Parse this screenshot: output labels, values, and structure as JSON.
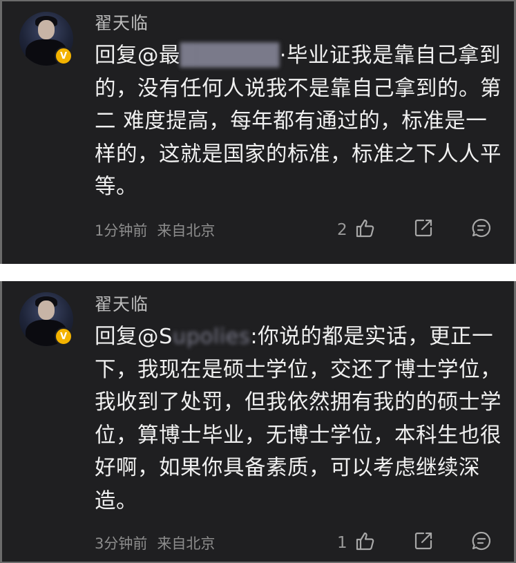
{
  "comments": [
    {
      "username": "翟天临",
      "verified_badge": "V",
      "reply_prefix": "回复@",
      "mention_visible": "最",
      "mention_obscured": "██████",
      "text": "·毕业证我是靠自己拿到的，没有任何人说我不是靠自己拿到的。第二 难度提高，每年都有通过的，标准是一样的，这就是国家的标准，标准之下人人平等。",
      "time": "1分钟前",
      "source": "来自北京",
      "likes": "2"
    },
    {
      "username": "翟天临",
      "verified_badge": "V",
      "reply_prefix": "回复@",
      "mention_visible": "S",
      "mention_obscured": "upolies",
      "text": ":你说的都是实话，更正一下，我现在是硕士学位，交还了博士学位，我收到了处罚，但我依然拥有我的的硕士学位，算博士毕业，无博士学位，本科生也很好啊，如果你具备素质，可以考虑继续深造。",
      "time": "3分钟前",
      "source": "来自北京",
      "likes": "1"
    }
  ],
  "icons": {
    "like": "thumbs-up-icon",
    "share": "share-icon",
    "comment": "comment-icon",
    "verified": "verified-v-icon"
  },
  "colors": {
    "card_background": "#1f1f21",
    "verified_badge": "#f3b300",
    "text": "#f0f0f0",
    "meta": "#8d8d8d"
  }
}
